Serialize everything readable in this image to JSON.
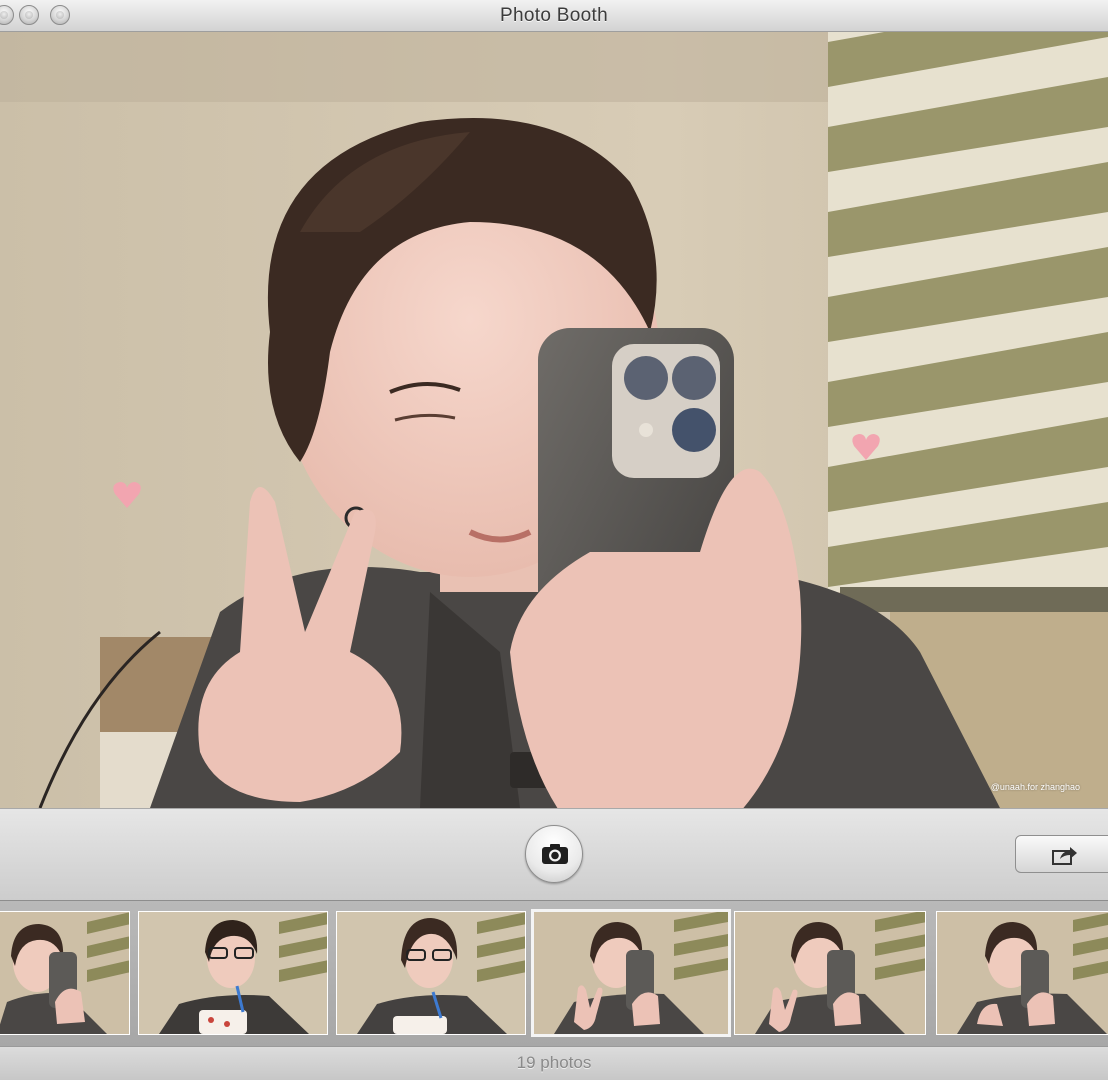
{
  "window": {
    "title": "Photo Booth",
    "buttons": [
      "close-button",
      "minimize-button",
      "zoom-button"
    ]
  },
  "viewport": {
    "watermark": "@unaah.for zhanghao",
    "decorations": [
      "heart-icon",
      "heart-icon"
    ]
  },
  "toolbar": {
    "shutter_icon": "camera-icon",
    "share_icon": "share-icon"
  },
  "filmstrip": {
    "thumbnails": [
      {
        "pose": "phone-selfie"
      },
      {
        "pose": "glasses-cup"
      },
      {
        "pose": "glasses-cup"
      },
      {
        "pose": "peace-sign-phone",
        "selected": true
      },
      {
        "pose": "peace-sign-phone"
      },
      {
        "pose": "phone-selfie"
      }
    ]
  },
  "status": {
    "photo_count": "19 photos"
  }
}
